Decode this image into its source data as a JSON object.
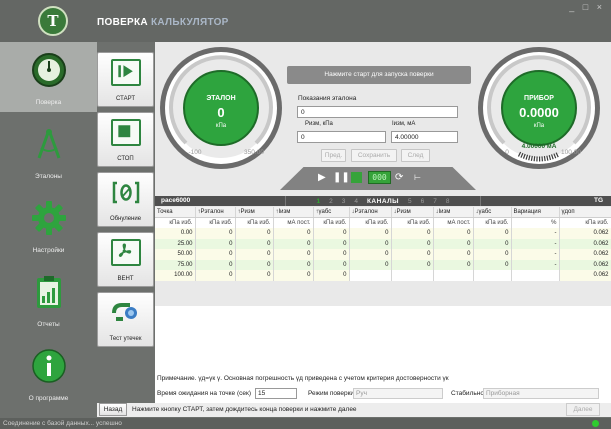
{
  "window": {
    "controls": "_ □ ×"
  },
  "top_tabs": [
    {
      "label": "ПОВЕРКА"
    },
    {
      "label": "КАЛЬКУЛЯТОР"
    }
  ],
  "logo": {
    "letter": "T"
  },
  "sidebar": {
    "items": [
      {
        "label": "Поверка",
        "icon": "gauge-icon"
      },
      {
        "label": "Эталоны",
        "icon": "compass-icon"
      },
      {
        "label": "Настройки",
        "icon": "gear-icon"
      },
      {
        "label": "Отчеты",
        "icon": "clipboard-icon"
      },
      {
        "label": "О программе",
        "icon": "info-icon"
      }
    ]
  },
  "actions": [
    {
      "label": "СТАРТ",
      "icon": "play-icon"
    },
    {
      "label": "СТОП",
      "icon": "stop-icon"
    },
    {
      "label": "Обнуление",
      "icon": "zero-icon"
    },
    {
      "label": "ВЕНТ",
      "icon": "fan-icon"
    },
    {
      "label": "Тест утечек",
      "icon": "leak-test-icon"
    }
  ],
  "gauge_left": {
    "title": "ЭТАЛОН",
    "value": "0",
    "unit": "кПа",
    "min": "-100",
    "max": "350.00"
  },
  "gauge_right": {
    "title": "ПРИБОР",
    "value": "0.0000",
    "unit": "кПа",
    "current": "4.00000 мА",
    "min": "0",
    "max": "100.00"
  },
  "hint": "Нажмите старт для запуска поверки",
  "reference": {
    "title": "Показания эталона",
    "value": "0",
    "p_label": "Pизм, кПа",
    "i_label": "Iизм, мА",
    "p_value": "0",
    "i_value": "4.00000"
  },
  "point_buttons": {
    "prev": "Пред.",
    "save": "Сохранить",
    "next": "След"
  },
  "led": "000",
  "device_name": "pace6000",
  "tg_label": "TG",
  "channels": {
    "numbers": [
      "1",
      "2",
      "3",
      "4",
      "5",
      "6",
      "7",
      "8"
    ],
    "label": "КАНАЛЫ"
  },
  "table": {
    "headers": [
      "Точка",
      "↑Pэталон",
      "↑Pизм",
      "↑Iизм",
      "↑γабс",
      "↓Pэталон",
      "↓Pизм",
      "↓Iизм",
      "↓γабс",
      "Вариация",
      "γдоп"
    ],
    "units": [
      "кПа изб.",
      "кПа изб.",
      "кПа изб.",
      "мА пост.",
      "кПа изб.",
      "кПа изб.",
      "кПа изб.",
      "мА пост.",
      "кПа изб.",
      "%",
      "кПа изб."
    ],
    "rows": [
      [
        "0.00",
        "0",
        "0",
        "0",
        "0",
        "0",
        "0",
        "0",
        "0",
        "-",
        "0.062"
      ],
      [
        "25.00",
        "0",
        "0",
        "0",
        "0",
        "0",
        "0",
        "0",
        "0",
        "-",
        "0.062"
      ],
      [
        "50.00",
        "0",
        "0",
        "0",
        "0",
        "0",
        "0",
        "0",
        "0",
        "-",
        "0.062"
      ],
      [
        "75.00",
        "0",
        "0",
        "0",
        "0",
        "0",
        "0",
        "0",
        "0",
        "-",
        "0.062"
      ],
      [
        "100.00",
        "0",
        "0",
        "0",
        "0",
        "",
        "",
        "",
        "",
        "",
        "0.062"
      ]
    ]
  },
  "note": "Примечание. γд=γк γ. Основная погрешность γд приведена с учетом критерия достоверности γк",
  "wait": {
    "label": "Время ожидания на точке (сек)",
    "value": "15"
  },
  "mode": {
    "label": "Режим поверки",
    "value": "Руч"
  },
  "stability": {
    "label": "Стабильность",
    "value": "Приборная"
  },
  "nav": {
    "back": "Назад",
    "instruction": "Нажмите кнопку СТАРТ, затем дождитесь конца поверки и нажмите далее",
    "next": "Далее"
  },
  "status": {
    "text": "Соединение с базой данных... успешно"
  },
  "colors": {
    "accent": "#2e8540",
    "dial_green": "#2ea43e",
    "led": "#36a33a"
  }
}
